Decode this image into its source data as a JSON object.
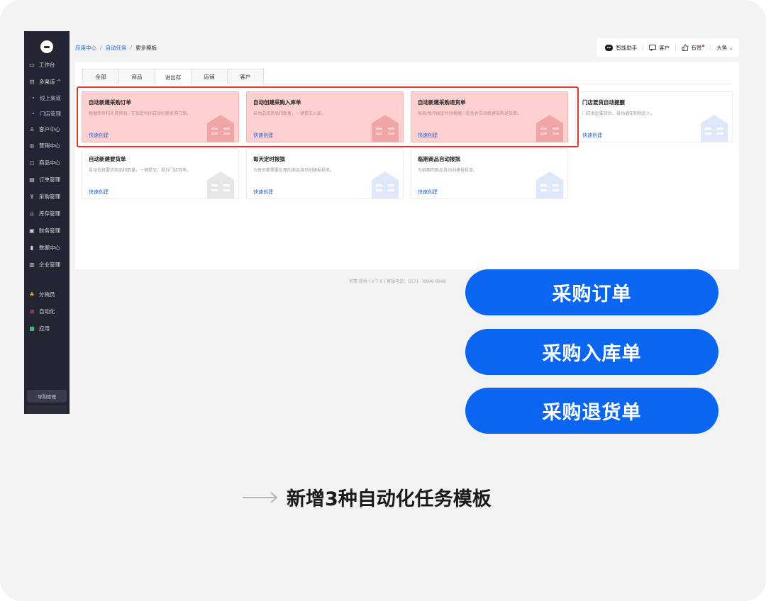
{
  "sidebar": {
    "items": [
      {
        "label": "工作台",
        "icon": "monitor-icon",
        "glyph": "▭"
      },
      {
        "label": "多渠道 ^",
        "icon": "channel-icon",
        "glyph": "⊟"
      },
      {
        "label": "线上渠道",
        "sub": true
      },
      {
        "label": "门店管理",
        "sub": true
      },
      {
        "label": "客户中心",
        "icon": "user-icon",
        "glyph": "♙"
      },
      {
        "label": "营销中心",
        "icon": "target-icon",
        "glyph": "◎"
      },
      {
        "label": "商品中心",
        "icon": "bag-icon",
        "glyph": "◻"
      },
      {
        "label": "订单管理",
        "icon": "document-icon",
        "glyph": "▤"
      },
      {
        "label": "采购管理",
        "icon": "cart-icon",
        "glyph": "⊻"
      },
      {
        "label": "库存管理",
        "icon": "warehouse-icon",
        "glyph": "⌂"
      },
      {
        "label": "财务管理",
        "icon": "finance-icon",
        "glyph": "▣"
      },
      {
        "label": "数据中心",
        "icon": "bar-chart-icon",
        "glyph": "▮"
      },
      {
        "label": "企业管理",
        "icon": "building-icon",
        "glyph": "▥"
      },
      {
        "label": "分销员",
        "icon": "distributor-icon",
        "glyph": "♣",
        "color": "#f0a020"
      },
      {
        "label": "自动化",
        "icon": "automation-icon",
        "glyph": "⊠",
        "color": "#d04a8a"
      },
      {
        "label": "应用",
        "icon": "apps-icon",
        "glyph": "■",
        "color": "#3cb878"
      }
    ],
    "bottom_label": "导购管理"
  },
  "breadcrumb": {
    "app_center": "应用中心",
    "auto_task": "自动任务",
    "current": "更多模板",
    "sep": "/"
  },
  "header": {
    "assistant": "智能助手",
    "customer": "客户",
    "youzan": "有赞",
    "user": "大鱼 ⌄"
  },
  "tabs": [
    "全部",
    "商品",
    "进出存",
    "店铺",
    "客户"
  ],
  "active_tab": 2,
  "cards": [
    {
      "title": "自动新建采购订单",
      "desc": "根据库存和补货预测，在指定时间自动创建采购订单。",
      "action": "快速创建",
      "highlight": true
    },
    {
      "title": "自动创建采购入库单",
      "desc": "自动选择商品和数量，一键提交入库。",
      "action": "快速创建",
      "highlight": true
    },
    {
      "title": "自动新建采购退货单",
      "desc": "每周/每月固定时间根据一定条件自动新建采购退货单。",
      "action": "快速创建",
      "highlight": true
    },
    {
      "title": "门店要货自动提醒",
      "desc": "门店发起要货后，自动通知到指定人。",
      "action": "快速创建",
      "highlight": false
    },
    {
      "title": "自动新建要货单",
      "desc": "自动选择要货商品和数量，一键提交，提升门店效率。",
      "action": "快速创建",
      "highlight": false
    },
    {
      "title": "每天定时报损",
      "desc": "为每天都需要处理的商品自动创建报损单。",
      "action": "快速创建",
      "highlight": false
    },
    {
      "title": "临期商品自动报损",
      "desc": "为临期的商品自动创建报损单。",
      "action": "快速创建",
      "highlight": false
    }
  ],
  "footer": "有赞 提供 | V 7.0 | 客服电话：0571 - 8998 8848",
  "pills": [
    "采购订单",
    "采购入库单",
    "采购退货单"
  ],
  "caption": "新增3种自动化任务模板",
  "colors": {
    "accent": "#0a66f0",
    "sidebar_bg": "#232532",
    "highlight_frame": "#e0352b",
    "highlight_fill": "#ffd0d0",
    "link": "#2a63d9"
  }
}
